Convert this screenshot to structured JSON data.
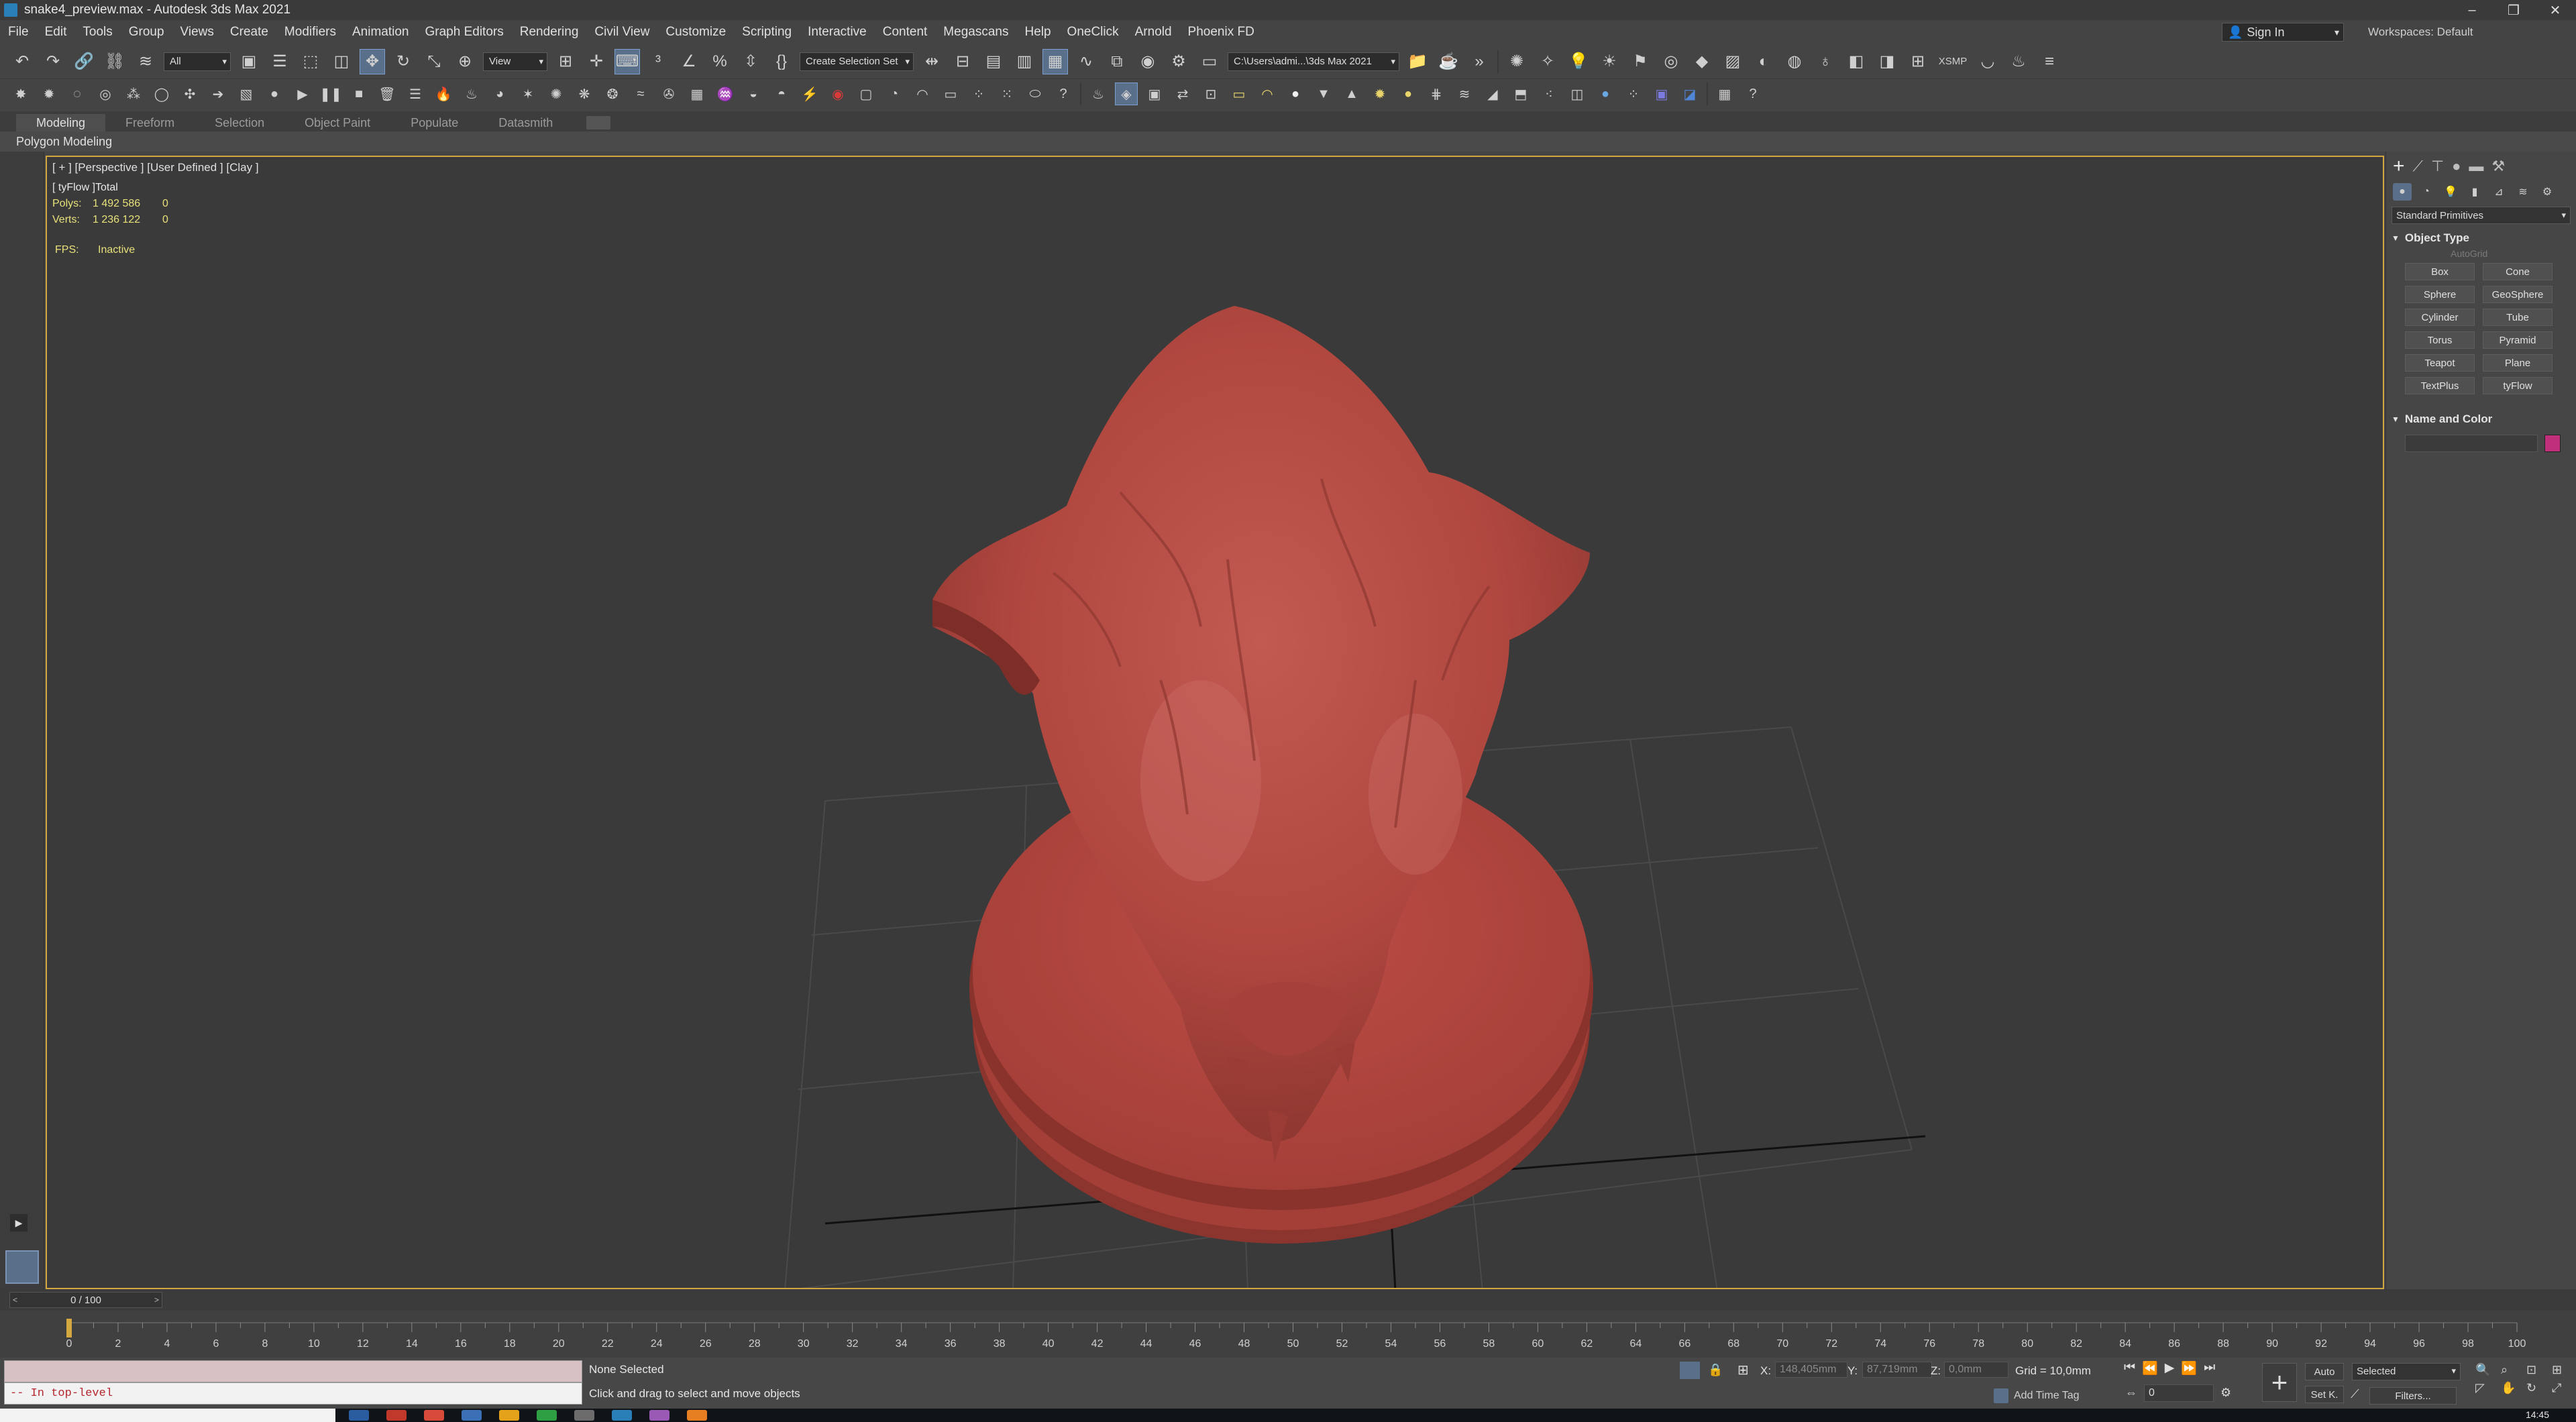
{
  "window": {
    "title": "snake4_preview.max - Autodesk 3ds Max 2021",
    "buttons": [
      "–",
      "❐",
      "✕"
    ]
  },
  "menu": {
    "items": [
      "File",
      "Edit",
      "Tools",
      "Group",
      "Views",
      "Create",
      "Modifiers",
      "Animation",
      "Graph Editors",
      "Rendering",
      "Civil View",
      "Customize",
      "Scripting",
      "Interactive",
      "Content",
      "Megascans",
      "Help",
      "OneClick",
      "Arnold",
      "Phoenix FD"
    ],
    "sign_in": "Sign In",
    "workspaces": "Workspaces: Default"
  },
  "toolbar": {
    "selection_filter": "All",
    "ref_coord": "View",
    "named_selection": "Create Selection Set",
    "project_path": "C:\\Users\\admi...\\3ds Max 2021",
    "xsmp": "XSMP"
  },
  "ribbon": {
    "tabs": [
      "Modeling",
      "Freeform",
      "Selection",
      "Object Paint",
      "Populate",
      "Datasmith"
    ],
    "active_tab": "Modeling",
    "sub_label": "Polygon Modeling"
  },
  "viewport": {
    "label": "[ + ] [Perspective ] [User Defined ] [Clay ]",
    "stats_header": "[ tyFlow ]Total",
    "polys_label": "Polys:",
    "polys_total": "1 492 586",
    "polys_sel": "0",
    "verts_label": "Verts:",
    "verts_total": "1 236 122",
    "verts_sel": "0",
    "fps_label": "FPS:",
    "fps_value": "Inactive",
    "model_color": "#b5473f",
    "border_color": "#d4a73f"
  },
  "command_panel": {
    "category": "Standard Primitives",
    "object_type_title": "Object Type",
    "autogrid": "AutoGrid",
    "objects": [
      "Box",
      "Cone",
      "Sphere",
      "GeoSphere",
      "Cylinder",
      "Tube",
      "Torus",
      "Pyramid",
      "Teapot",
      "Plane",
      "TextPlus",
      "tyFlow"
    ],
    "name_color_title": "Name and Color",
    "swatch_color": "#c0307a"
  },
  "timeline": {
    "frame_display": "0 / 100",
    "ticks": [
      0,
      2,
      4,
      6,
      8,
      10,
      12,
      14,
      16,
      18,
      20,
      22,
      24,
      26,
      28,
      30,
      32,
      34,
      36,
      38,
      40,
      42,
      44,
      46,
      48,
      50,
      52,
      54,
      56,
      58,
      60,
      62,
      64,
      66,
      68,
      70,
      72,
      74,
      76,
      78,
      80,
      82,
      84,
      86,
      88,
      90,
      92,
      94,
      96,
      98,
      100
    ]
  },
  "status": {
    "maxscript_output": "-- In top-level",
    "selection": "None Selected",
    "prompt": "Click and drag to select and move objects",
    "x_label": "X:",
    "x_value": "148,405mm",
    "y_label": "Y:",
    "y_value": "87,719mm",
    "z_label": "Z:",
    "z_value": "0,0mm",
    "grid": "Grid = 10,0mm",
    "add_time_tag": "Add Time Tag",
    "auto_key": "Auto",
    "set_key": "Set K.",
    "selected": "Selected",
    "filters": "Filters...",
    "frame": "0"
  },
  "taskbar": {
    "clock": "14:45"
  }
}
